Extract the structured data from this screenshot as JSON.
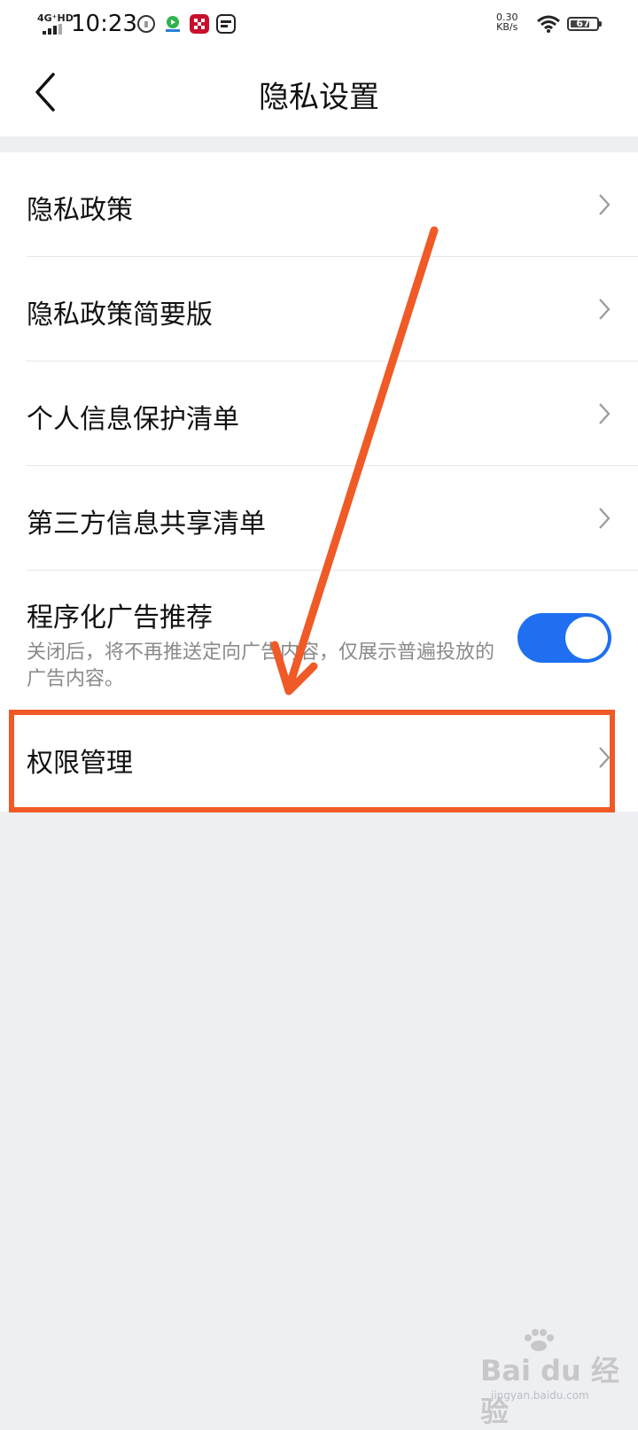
{
  "status_bar": {
    "network": "4G⁺HD",
    "time": "10:23",
    "speed_value": "0.30",
    "speed_unit": "KB/s",
    "battery": "67"
  },
  "header": {
    "title": "隐私设置"
  },
  "settings": {
    "privacy_policy": "隐私政策",
    "privacy_policy_brief": "隐私政策简要版",
    "personal_info_list": "个人信息保护清单",
    "third_party_list": "第三方信息共享清单",
    "programmatic_ads": {
      "label": "程序化广告推荐",
      "description": "关闭后，将不再推送定向广告内容，仅展示普遍投放的广告内容。",
      "enabled": true
    },
    "permission_management": "权限管理"
  },
  "colors": {
    "accent": "#1f6ff0",
    "annotation": "#ef5a26",
    "background": "#eeeff3"
  },
  "watermark": {
    "text": "Bai du 经验",
    "sub": "jingyan.baidu.com"
  }
}
